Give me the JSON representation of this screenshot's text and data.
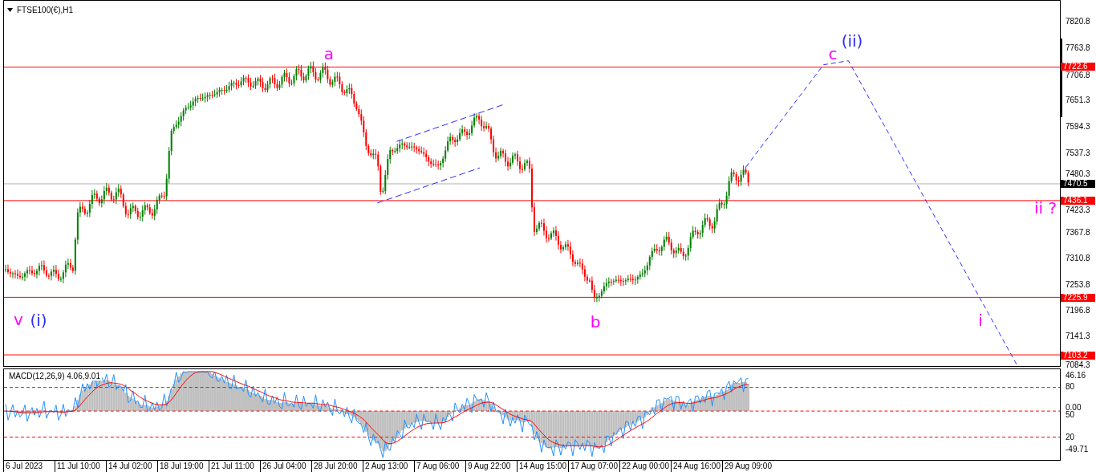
{
  "chart": {
    "title": "FTSE100(€),H1",
    "price_ticks": [
      "7820.8",
      "7763.8",
      "7706.8",
      "7651.3",
      "7594.3",
      "7537.3",
      "7480.3",
      "7423.3",
      "7367.8",
      "7310.8",
      "7253.8",
      "7196.8",
      "7141.3",
      "7084.3"
    ],
    "price_levels": [
      {
        "label": "7722.6",
        "kind": "level"
      },
      {
        "label": "7436.1",
        "kind": "level"
      },
      {
        "label": "7225.9",
        "kind": "level"
      },
      {
        "label": "7103.2",
        "kind": "level"
      }
    ],
    "current_price": {
      "label": "7470.5"
    },
    "wave_labels": [
      {
        "text": "a",
        "color": "#ff00ff"
      },
      {
        "text": "c",
        "color": "#ff00ff"
      },
      {
        "text": "(ii)",
        "color": "#2b2bff"
      },
      {
        "text": "ii ?",
        "color": "#ff00ff"
      },
      {
        "text": "v",
        "color": "#ff00ff"
      },
      {
        "text": "(i)",
        "color": "#2b2bff"
      },
      {
        "text": "b",
        "color": "#ff00ff"
      },
      {
        "text": "i",
        "color": "#ff00ff"
      }
    ]
  },
  "macd": {
    "title": "MACD(12,26,9) 4.06,9.01",
    "axis_labels": [
      "46.16",
      "80",
      "0.00",
      "50",
      "20",
      "-49.71"
    ]
  },
  "time_axis": [
    "6 Jul 2023",
    "11 Jul 10:00",
    "14 Jul 02:00",
    "18 Jul 19:00",
    "21 Jul 11:00",
    "26 Jul 04:00",
    "28 Jul 20:00",
    "2 Aug 13:00",
    "7 Aug 06:00",
    "9 Aug 22:00",
    "14 Aug 15:00",
    "17 Aug 07:00",
    "22 Aug 00:00",
    "24 Aug 16:00",
    "29 Aug 09:00"
  ]
}
